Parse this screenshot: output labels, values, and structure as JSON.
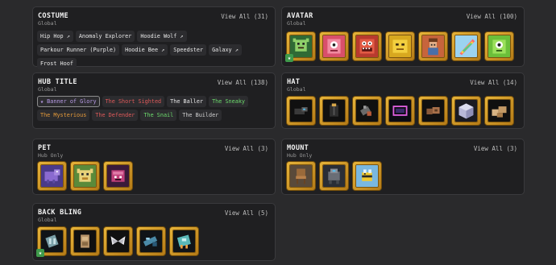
{
  "costume": {
    "title": "COSTUME",
    "scope": "Global",
    "view_all": "View All (31)",
    "chips": [
      "Hip Hop ↗",
      "Anomaly Explorer",
      "Hoodie Wolf ↗",
      "Parkour Runner (Purple)",
      "Hoodie Bee ↗",
      "Speedster",
      "Galaxy ↗",
      "Frost Hoof"
    ]
  },
  "avatar": {
    "title": "AVATAR",
    "scope": "Global",
    "view_all": "View All (100)",
    "items": [
      "avatar-green-gremlin",
      "avatar-pink-cube-monster",
      "avatar-red-toothy-monster",
      "avatar-yellow-blob",
      "avatar-explorer",
      "avatar-rainbow-feather",
      "avatar-green-cyclops"
    ]
  },
  "hub_title": {
    "title": "HUB TITLE",
    "scope": "Global",
    "view_all": "View All (138)",
    "chips": [
      {
        "label": "★ Banner of Glory",
        "color": "#b89be6",
        "selected": true
      },
      {
        "label": "The Short Sighted",
        "color": "#e05a5a"
      },
      {
        "label": "The Baller",
        "color": "#e8e8e8"
      },
      {
        "label": "The Sneaky",
        "color": "#6ddc6d"
      },
      {
        "label": "The Mysterious",
        "color": "#e59a3a"
      },
      {
        "label": "The Defender",
        "color": "#e05a5a"
      },
      {
        "label": "The Snail",
        "color": "#6ddc6d"
      },
      {
        "label": "The Builder",
        "color": "#cfcfcf"
      }
    ]
  },
  "hat": {
    "title": "HAT",
    "scope": "Global",
    "view_all": "View All (14)",
    "items": [
      "hat-dark-gadget",
      "hat-black-vest",
      "hat-blaster",
      "hat-neon-frame",
      "hat-wooden-crate",
      "hat-crystal-cube",
      "hat-wooden-blocks"
    ]
  },
  "pet": {
    "title": "PET",
    "scope": "Hub Only",
    "view_all": "View All (3)",
    "items": [
      "pet-purple-dino",
      "pet-yellow-gremlin",
      "pet-magenta-beast"
    ]
  },
  "mount": {
    "title": "MOUNT",
    "scope": "Hub Only",
    "view_all": "View All (3)",
    "items": [
      "mount-wooden-chair",
      "mount-gray-mech",
      "mount-bee-rider"
    ]
  },
  "back_bling": {
    "title": "BACK BLING",
    "scope": "Global",
    "view_all": "View All (5)",
    "items": [
      "back-bling-jetpack",
      "back-bling-wooden-pack",
      "back-bling-wings",
      "back-bling-blaster",
      "back-bling-teal-jetpack"
    ]
  }
}
